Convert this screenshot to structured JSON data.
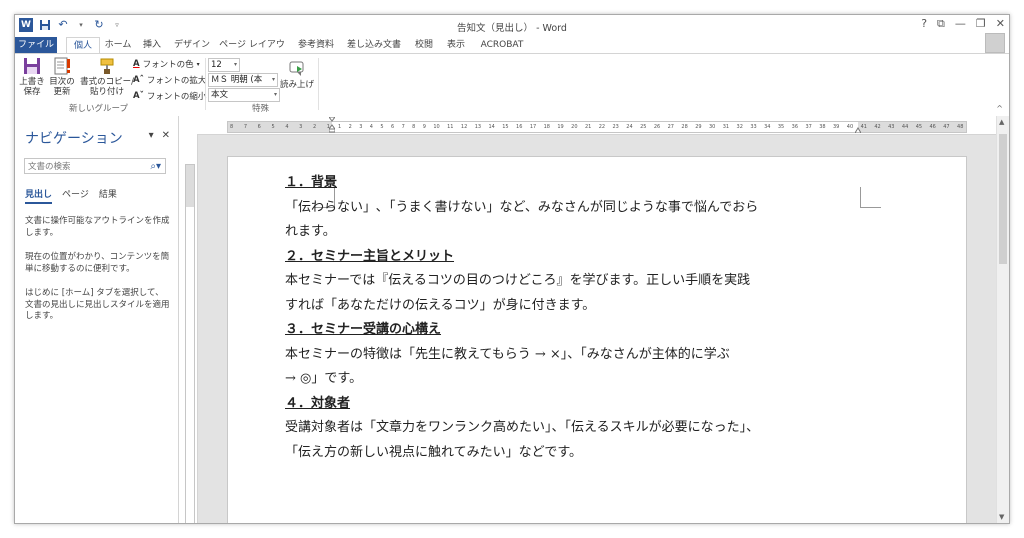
{
  "window": {
    "title": "告知文（見出し） - Word",
    "controls": [
      "?",
      "⧉",
      "—",
      "❐",
      "✕"
    ]
  },
  "tabs": [
    {
      "label": "ファイル"
    },
    {
      "label": "個人"
    },
    {
      "label": "ホーム"
    },
    {
      "label": "挿入"
    },
    {
      "label": "デザイン"
    },
    {
      "label": "ページ レイアウト"
    },
    {
      "label": "参考資料"
    },
    {
      "label": "差し込み文書"
    },
    {
      "label": "校閲"
    },
    {
      "label": "表示"
    },
    {
      "label": "ACROBAT"
    }
  ],
  "ribbon": {
    "save_label1": "上書き",
    "save_label2": "保存",
    "toc_label1": "目次の",
    "toc_label2": "更新",
    "format_copy_label1": "書式のコピー/",
    "format_copy_label2": "貼り付け",
    "font_color": "フォントの色",
    "font_grow": "フォントの拡大",
    "font_shrink": "フォントの縮小",
    "group1_label": "新しいグループ",
    "font_size": "12",
    "font_name": "ＭＳ 明朝 (本",
    "style_name": "本文",
    "read_aloud": "読み上げ",
    "group2_label": "特殊"
  },
  "nav": {
    "title": "ナビゲーション",
    "search_placeholder": "文書の検索",
    "tabs": [
      "見出し",
      "ページ",
      "結果"
    ],
    "msg1": "文書に操作可能なアウトラインを作成します。",
    "msg2": "現在の位置がわかり、コンテンツを簡単に移動するのに便利です。",
    "msg3": "はじめに [ホーム] タブを選択して、文書の見出しに見出しスタイルを適用します。"
  },
  "ruler": {
    "left_numbers": [
      "8",
      "7",
      "6",
      "5",
      "4",
      "3",
      "2",
      "1"
    ],
    "numbers": [
      "1",
      "2",
      "3",
      "4",
      "5",
      "6",
      "7",
      "8",
      "9",
      "10",
      "11",
      "12",
      "13",
      "14",
      "15",
      "16",
      "17",
      "18",
      "19",
      "20",
      "21",
      "22",
      "23",
      "24",
      "25",
      "26",
      "27",
      "28",
      "29",
      "30",
      "31",
      "32",
      "33",
      "34",
      "35",
      "36",
      "37",
      "38",
      "39",
      "40",
      "41",
      "42",
      "43",
      "44",
      "45",
      "46",
      "47",
      "48"
    ]
  },
  "document": {
    "h1": "１．背景",
    "p1a": "「伝わらない」､「うまく書けない」など、みなさんが同じような事で悩んでおら",
    "p1b": "れます。",
    "h2": "２．セミナー主旨とメリット",
    "p2a": "本セミナーでは『伝えるコツの目のつけどころ』を学びます。正しい手順を実践",
    "p2b": "すれば「あなただけの伝えるコツ」が身に付きます。",
    "h3": "３．セミナー受講の心構え",
    "p3a": "本セミナーの特徴は「先生に教えてもらう → ×」、「みなさんが主体的に学ぶ",
    "p3b": "→ ◎」です。",
    "h4": "４．対象者",
    "p4a": "受講対象者は「文章力をワンランク高めたい」、「伝えるスキルが必要になった」、",
    "p4b": "「伝え方の新しい視点に触れてみたい」などです。"
  }
}
